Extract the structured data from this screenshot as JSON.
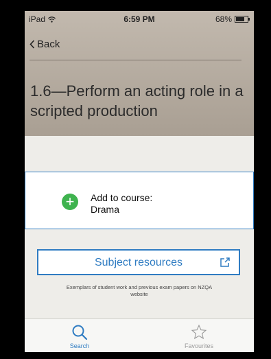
{
  "status": {
    "device": "iPad",
    "time": "6:59 PM",
    "battery": "68%"
  },
  "nav": {
    "back_label": "Back"
  },
  "standard": {
    "title": "1.6—Perform an acting role in a scripted production"
  },
  "course": {
    "add_label": "Add to course:",
    "course_name": "Drama",
    "add_icon": "plus-circle-icon"
  },
  "resources": {
    "button_label": "Subject resources",
    "note": "Exemplars of student work and previous exam papers on NZQA website",
    "icon": "external-link-icon"
  },
  "tabs": [
    {
      "label": "Search",
      "icon": "search-icon",
      "active": true
    },
    {
      "label": "Favourites",
      "icon": "star-icon",
      "active": false
    }
  ],
  "colors": {
    "accent": "#2f7cc2",
    "add_green": "#3fb34f",
    "header": "#b5ab9f"
  }
}
